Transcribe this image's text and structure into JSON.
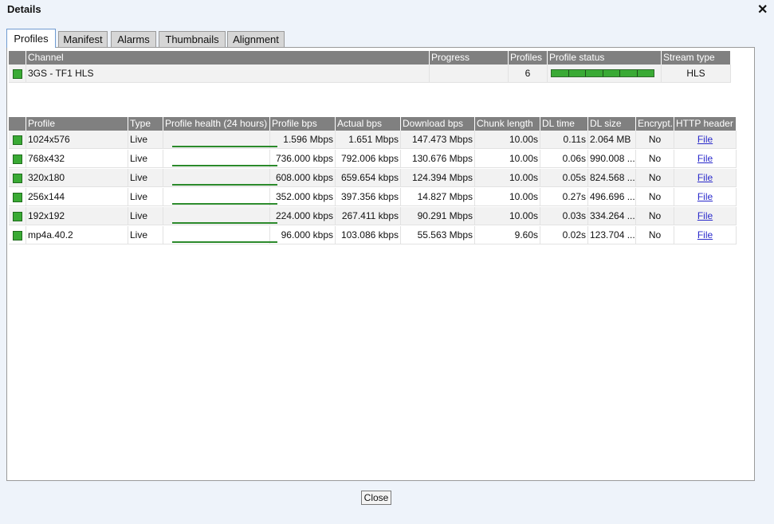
{
  "window": {
    "title": "Details",
    "close_glyph": "✕"
  },
  "tabs": [
    {
      "label": "Profiles",
      "active": true
    },
    {
      "label": "Manifest"
    },
    {
      "label": "Alarms"
    },
    {
      "label": "Thumbnails"
    },
    {
      "label": "Alignment"
    }
  ],
  "channel_table": {
    "headers": [
      "Channel",
      "Progress",
      "Profiles",
      "Profile status",
      "Stream type"
    ],
    "row": {
      "channel": "3GS - TF1 HLS",
      "progress": "",
      "profiles": "6",
      "status_segments": 6,
      "stream_type": "HLS",
      "status_color": "#3aaa35"
    }
  },
  "profile_table": {
    "headers": [
      "Profile",
      "Type",
      "Profile health (24 hours)",
      "Profile bps",
      "Actual bps",
      "Download bps",
      "Chunk length",
      "DL time",
      "DL size",
      "Encrypt.",
      "HTTP header"
    ],
    "rows": [
      {
        "profile": "1024x576",
        "type": "Live",
        "profile_bps": "1.596 Mbps",
        "actual_bps": "1.651 Mbps",
        "download_bps": "147.473 Mbps",
        "chunk": "10.00s",
        "dl_time": "0.11s",
        "dl_size": "2.064 MB",
        "encrypt": "No",
        "http": "File"
      },
      {
        "profile": "768x432",
        "type": "Live",
        "profile_bps": "736.000 kbps",
        "actual_bps": "792.006 kbps",
        "download_bps": "130.676 Mbps",
        "chunk": "10.00s",
        "dl_time": "0.06s",
        "dl_size": "990.008 ...",
        "encrypt": "No",
        "http": "File"
      },
      {
        "profile": "320x180",
        "type": "Live",
        "profile_bps": "608.000 kbps",
        "actual_bps": "659.654 kbps",
        "download_bps": "124.394 Mbps",
        "chunk": "10.00s",
        "dl_time": "0.05s",
        "dl_size": "824.568 ...",
        "encrypt": "No",
        "http": "File"
      },
      {
        "profile": "256x144",
        "type": "Live",
        "profile_bps": "352.000 kbps",
        "actual_bps": "397.356 kbps",
        "download_bps": "14.827 Mbps",
        "chunk": "10.00s",
        "dl_time": "0.27s",
        "dl_size": "496.696 ...",
        "encrypt": "No",
        "http": "File"
      },
      {
        "profile": "192x192",
        "type": "Live",
        "profile_bps": "224.000 kbps",
        "actual_bps": "267.411 kbps",
        "download_bps": "90.291 Mbps",
        "chunk": "10.00s",
        "dl_time": "0.03s",
        "dl_size": "334.264 ...",
        "encrypt": "No",
        "http": "File"
      },
      {
        "profile": "mp4a.40.2",
        "type": "Live",
        "profile_bps": "96.000 kbps",
        "actual_bps": "103.086 kbps",
        "download_bps": "55.563 Mbps",
        "chunk": "9.60s",
        "dl_time": "0.02s",
        "dl_size": "123.704 ...",
        "encrypt": "No",
        "http": "File"
      }
    ]
  },
  "footer": {
    "close_label": "Close"
  },
  "colors": {
    "header_bg": "#808080",
    "ok_green": "#3aaa35",
    "zebra": "#f2f2f2",
    "link": "#2a2acb"
  }
}
